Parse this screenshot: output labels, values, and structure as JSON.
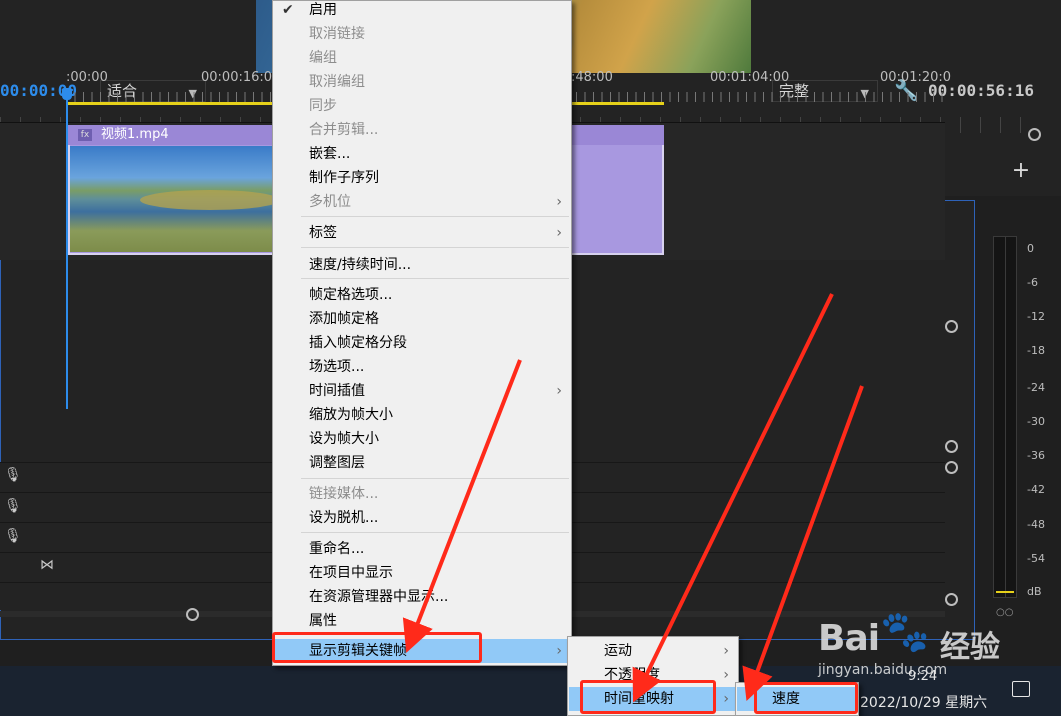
{
  "monitor": {
    "timecode_left": "00:00:00",
    "fit_select": "适合",
    "quality_select": "完整",
    "timecode_right": "00:00:56:16"
  },
  "timeline": {
    "ruler_labels": [
      ":00:00",
      "00:00:16:00",
      ":48:00",
      "00:01:04:00",
      "00:01:20:0"
    ],
    "clip_name": "视频1.mp4",
    "clip_fx": "fx"
  },
  "meter": {
    "db_labels": [
      "0",
      "-6",
      "-12",
      "-18",
      "-24",
      "-30",
      "-36",
      "-42",
      "-48",
      "-54",
      "dB"
    ]
  },
  "context_menu": {
    "items": [
      {
        "label": "启用",
        "checked": true,
        "disabled": false
      },
      {
        "label": "取消链接",
        "disabled": true
      },
      {
        "label": "编组",
        "disabled": true
      },
      {
        "label": "取消编组",
        "disabled": true
      },
      {
        "label": "同步",
        "disabled": true
      },
      {
        "label": "合并剪辑...",
        "disabled": true
      },
      {
        "label": "嵌套...",
        "disabled": false
      },
      {
        "label": "制作子序列",
        "disabled": false
      },
      {
        "label": "多机位",
        "disabled": true,
        "submenu": true
      },
      {
        "label": "标签",
        "disabled": false,
        "submenu": true
      },
      {
        "label": "速度/持续时间...",
        "disabled": false
      },
      {
        "label": "帧定格选项...",
        "disabled": false
      },
      {
        "label": "添加帧定格",
        "disabled": false
      },
      {
        "label": "插入帧定格分段",
        "disabled": false
      },
      {
        "label": "场选项...",
        "disabled": false
      },
      {
        "label": "时间插值",
        "disabled": false,
        "submenu": true
      },
      {
        "label": "缩放为帧大小",
        "disabled": false
      },
      {
        "label": "设为帧大小",
        "disabled": false
      },
      {
        "label": "调整图层",
        "disabled": false
      },
      {
        "label": "链接媒体...",
        "disabled": true
      },
      {
        "label": "设为脱机...",
        "disabled": false
      },
      {
        "label": "重命名...",
        "disabled": false
      },
      {
        "label": "在项目中显示",
        "disabled": false
      },
      {
        "label": "在资源管理器中显示...",
        "disabled": false
      },
      {
        "label": "属性",
        "disabled": false
      },
      {
        "label": "显示剪辑关键帧",
        "disabled": false,
        "submenu": true,
        "highlighted": true
      }
    ]
  },
  "submenu_keyframes": {
    "items": [
      "运动",
      "不透明度",
      "时间重映射"
    ]
  },
  "submenu_timeremap": {
    "items": [
      "速度"
    ]
  },
  "taskbar": {
    "time": "9:24",
    "date": "2022/10/29 星期六"
  },
  "watermark": {
    "brand": "Bai",
    "brand_cn": "经验",
    "url": "jingyan.baidu.com"
  },
  "colors": {
    "accent_blue": "#2d8ceb",
    "clip_purple": "#a898e0",
    "menu_highlight": "#91c9f7",
    "annotation_red": "#ff2a1a",
    "work_area_yellow": "#e6d11a"
  }
}
